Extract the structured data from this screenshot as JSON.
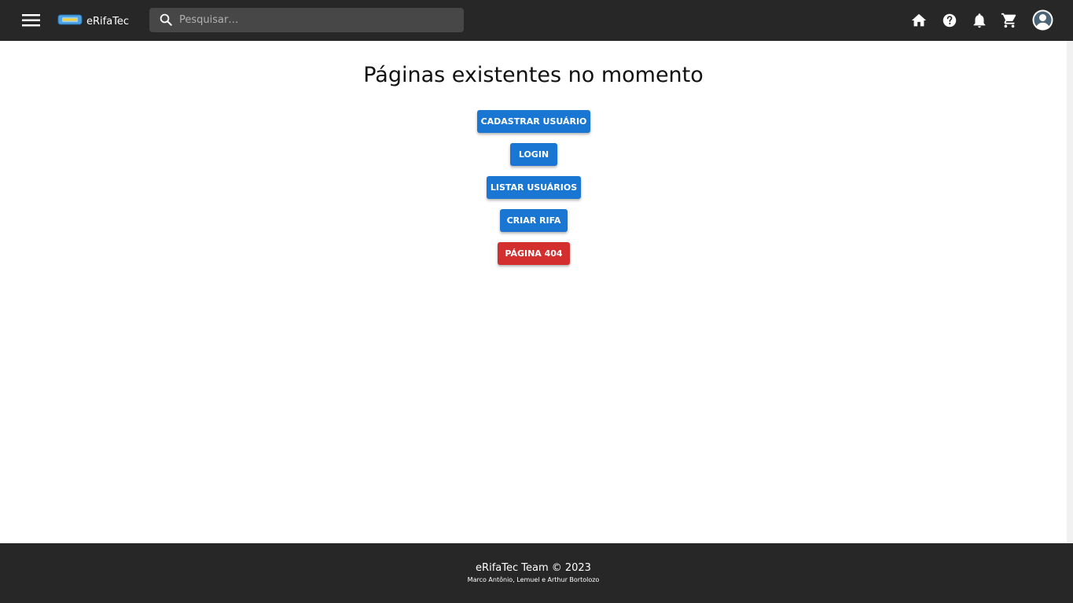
{
  "header": {
    "logo_text": "eRifaTec",
    "search_placeholder": "Pesquisar…",
    "icons": [
      "menu-icon",
      "ticket-logo-icon",
      "search-icon",
      "home-icon",
      "help-icon",
      "bell-icon",
      "cart-icon",
      "account-icon"
    ]
  },
  "main": {
    "title": "Páginas existentes no momento",
    "buttons": [
      {
        "label": "CADASTRAR USUÁRIO",
        "color": "#1976d2"
      },
      {
        "label": "LOGIN",
        "color": "#1976d2"
      },
      {
        "label": "LISTAR USUÁRIOS",
        "color": "#1976d2"
      },
      {
        "label": "CRIAR RIFA",
        "color": "#1976d2"
      },
      {
        "label": "PÁGINA 404",
        "color": "#d32f2f"
      }
    ]
  },
  "footer": {
    "title": "eRifaTec Team © 2023",
    "authors": "Marco Antônio, Lemuel e Arthur Bortolozo"
  },
  "colors": {
    "header_bg": "#272727",
    "search_bg": "#474747",
    "primary": "#1976d2",
    "error": "#d32f2f",
    "footer_bg": "#272727"
  }
}
